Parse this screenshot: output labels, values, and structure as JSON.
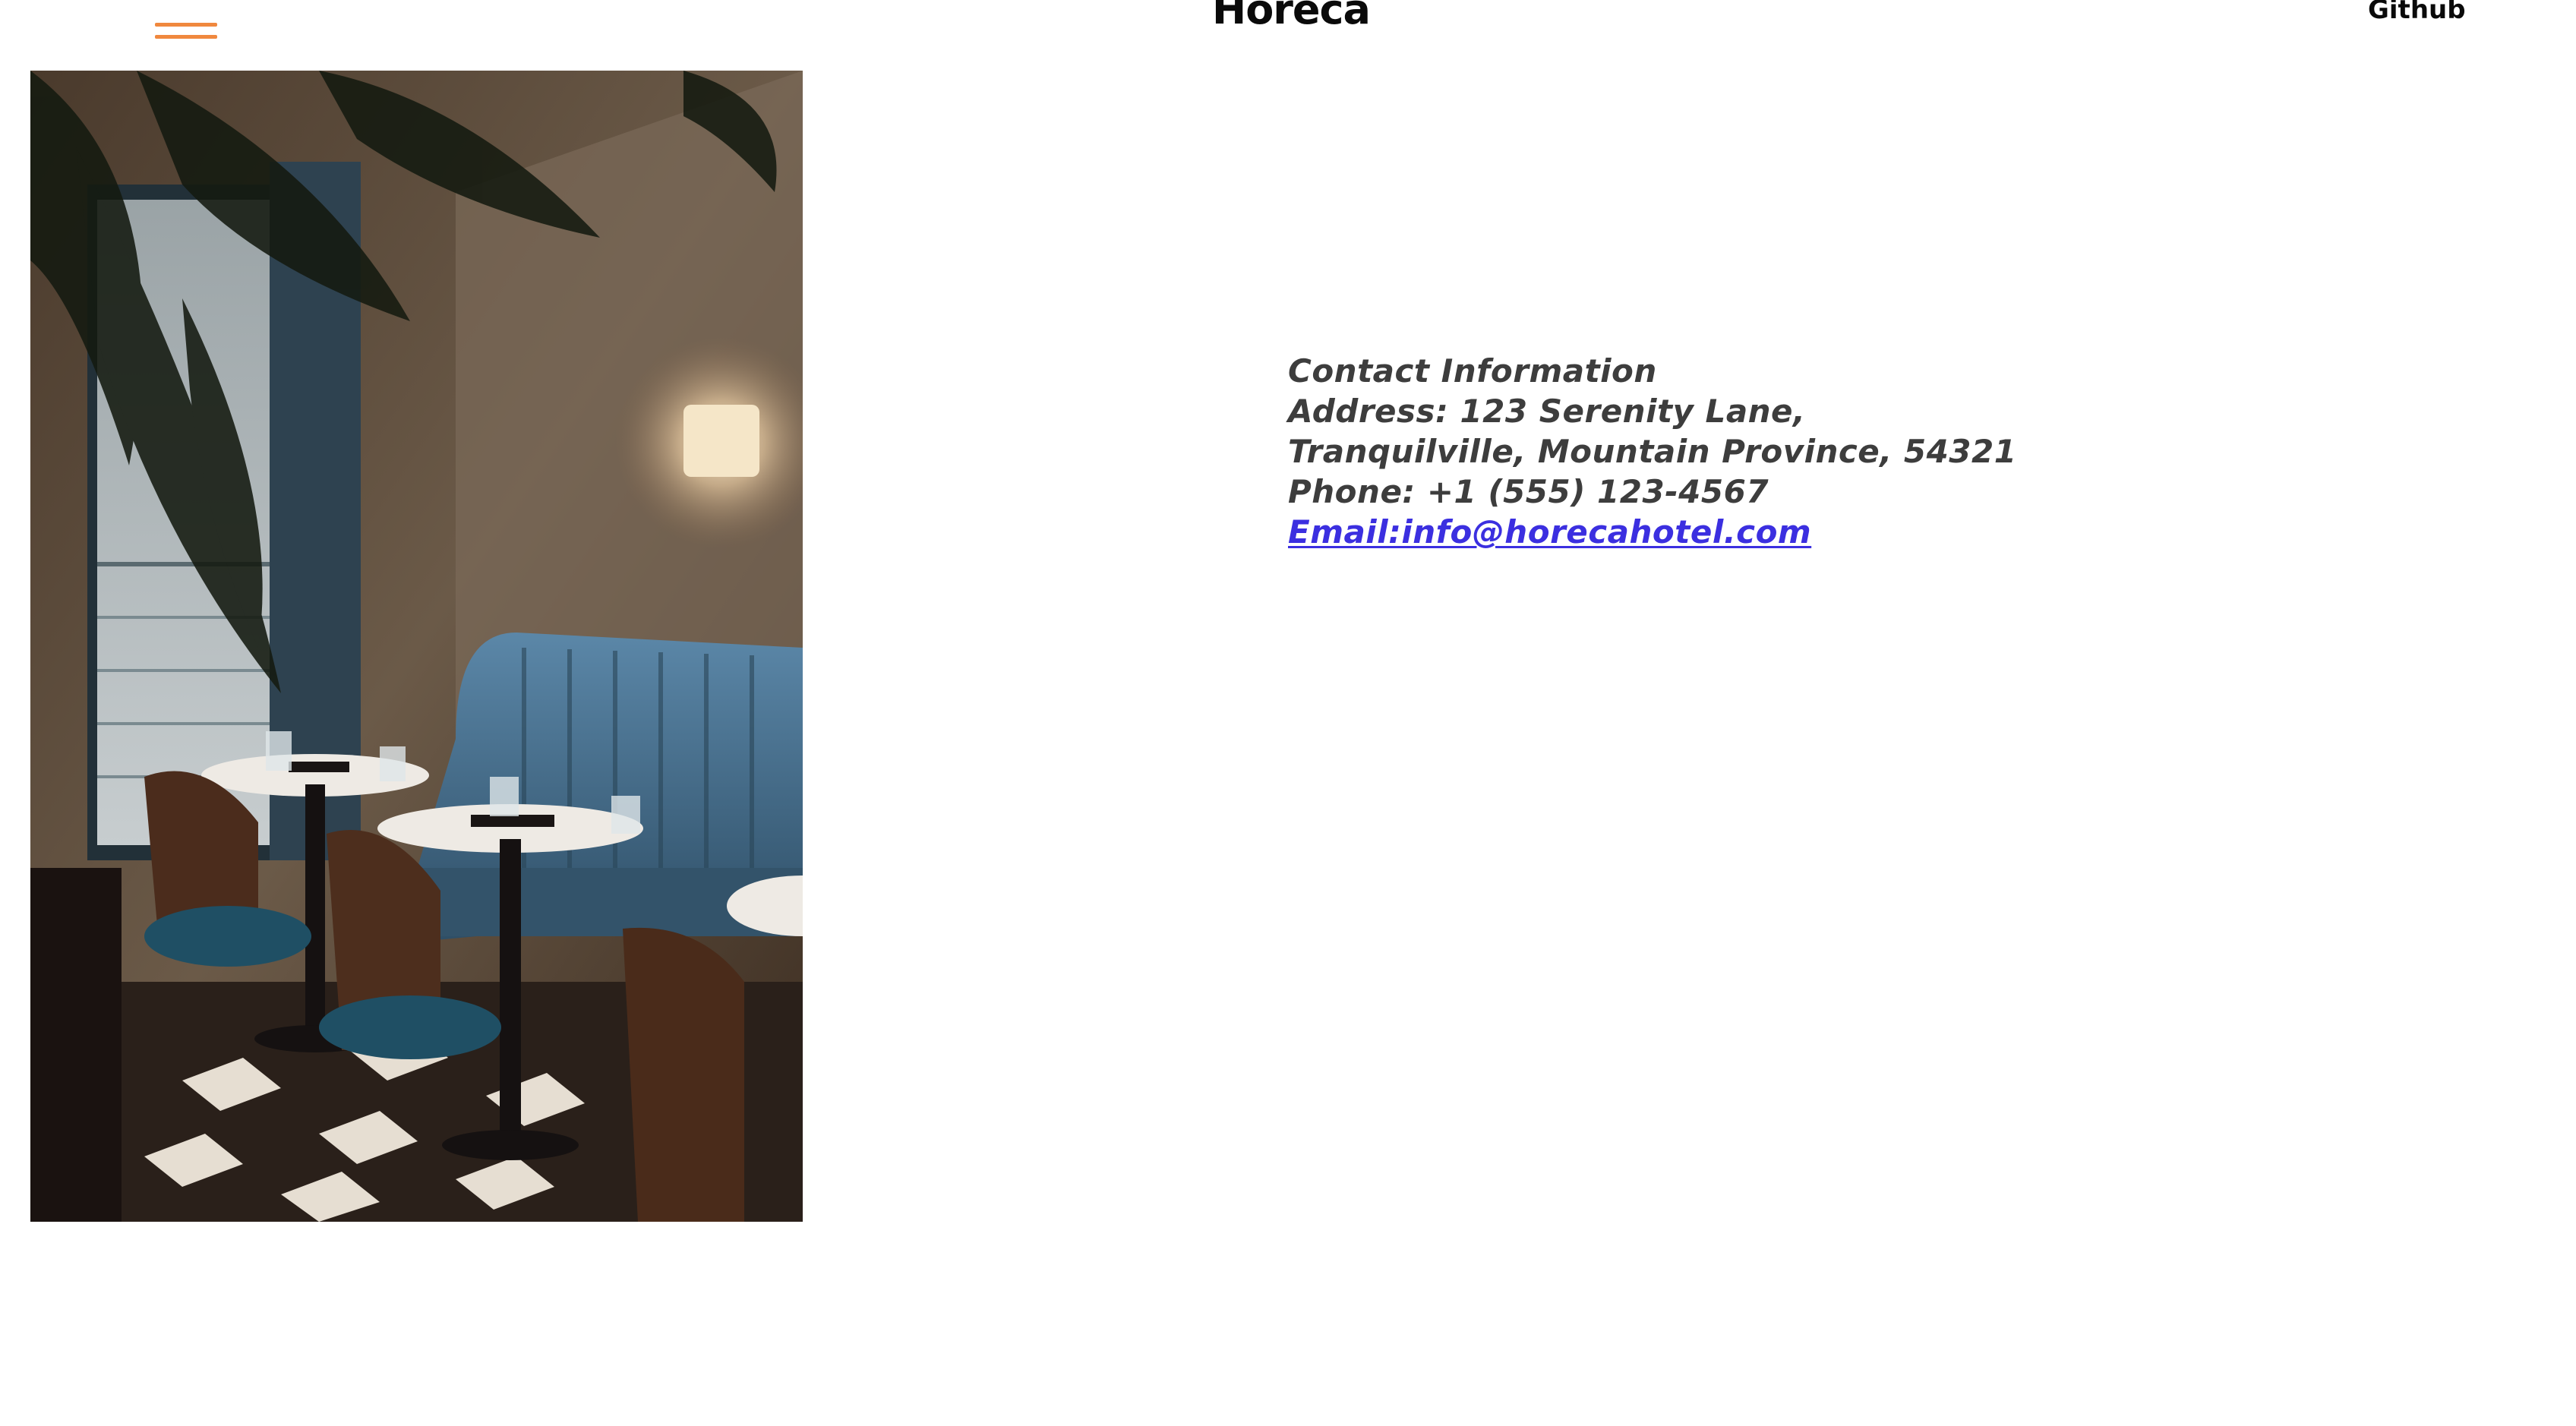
{
  "header": {
    "menu_icon": "hamburger-menu-icon",
    "brand": "Horeca",
    "nav_link": "Github"
  },
  "photo": {
    "subject": "restaurant-interior-photo"
  },
  "contact": {
    "heading": "Contact Information",
    "address_line1": "Address: 123 Serenity Lane,",
    "address_line2": "Tranquilville, Mountain Province, 54321",
    "phone": "Phone: +1 (555) 123-4567",
    "email": "Email:info@horecahotel.com"
  },
  "colors": {
    "accent": "#f0883e",
    "text": "#3d3d3d",
    "link": "#3b2fe0",
    "brand": "#0a0a0a"
  }
}
